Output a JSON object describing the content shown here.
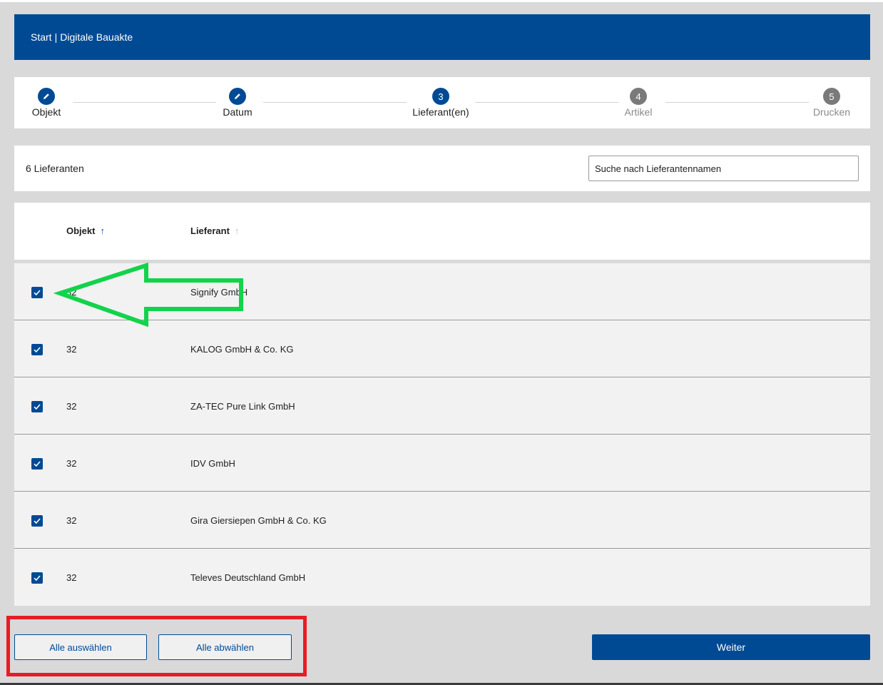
{
  "header": {
    "start": "Start",
    "separator": "|",
    "title": "Digitale Bauakte"
  },
  "stepper": {
    "steps": [
      {
        "label": "Objekt",
        "marker": "",
        "state": "done"
      },
      {
        "label": "Datum",
        "marker": "",
        "state": "done"
      },
      {
        "label": "Lieferant(en)",
        "marker": "3",
        "state": "active"
      },
      {
        "label": "Artikel",
        "marker": "4",
        "state": "inactive"
      },
      {
        "label": "Drucken",
        "marker": "5",
        "state": "inactive"
      }
    ]
  },
  "filter": {
    "count_label": "6 Lieferanten",
    "search_placeholder": "Suche nach Lieferantennamen"
  },
  "table": {
    "columns": [
      {
        "label": "Objekt",
        "sort": "ascending"
      },
      {
        "label": "Lieferant",
        "sort": "none"
      }
    ],
    "rows": [
      {
        "objekt": "32",
        "lieferant": "Signify GmbH",
        "checked": true
      },
      {
        "objekt": "32",
        "lieferant": "KALOG GmbH & Co. KG",
        "checked": true
      },
      {
        "objekt": "32",
        "lieferant": "ZA-TEC Pure Link GmbH",
        "checked": true
      },
      {
        "objekt": "32",
        "lieferant": "IDV GmbH",
        "checked": true
      },
      {
        "objekt": "32",
        "lieferant": "Gira Giersiepen GmbH & Co. KG",
        "checked": true
      },
      {
        "objekt": "32",
        "lieferant": "Televes Deutschland GmbH",
        "checked": true
      }
    ]
  },
  "actions": {
    "select_all": "Alle auswählen",
    "deselect_all": "Alle abwählen",
    "next": "Weiter"
  },
  "colors": {
    "brand": "#004a94",
    "annotation_green": "#12d34a",
    "annotation_red": "#e81c24"
  }
}
